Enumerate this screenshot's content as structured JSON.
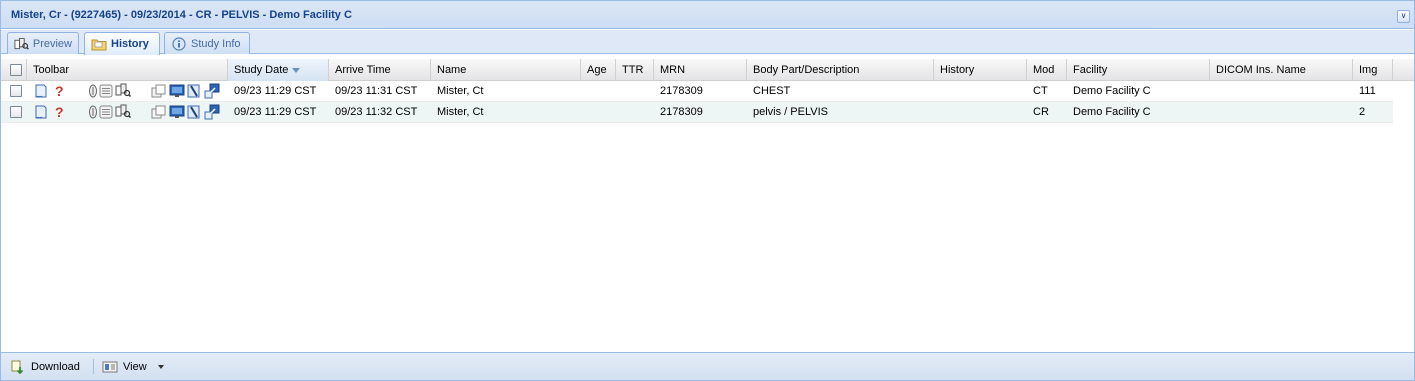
{
  "panel": {
    "title": "Mister, Cr - (9227465) - 09/23/2014 - CR - PELVIS - Demo Facility C"
  },
  "tabs": [
    {
      "label": "Preview",
      "icon": "preview-icon",
      "active": false
    },
    {
      "label": "History",
      "icon": "folder-icon",
      "active": true
    },
    {
      "label": "Study Info",
      "icon": "info-icon",
      "active": false
    }
  ],
  "grid": {
    "columns": [
      "Toolbar",
      "Study Date",
      "Arrive Time",
      "Name",
      "Age",
      "TTR",
      "MRN",
      "Body Part/Description",
      "History",
      "Mod",
      "Facility",
      "DICOM Ins. Name",
      "Img"
    ],
    "sorted_column": "Study Date",
    "sort_direction": "desc",
    "rows": [
      {
        "study_date": "09/23 11:29 CST",
        "arrive_time": "09/23 11:31 CST",
        "name": "Mister, Ct",
        "age": "",
        "ttr": "",
        "mrn": "2178309",
        "body_part": "CHEST",
        "history": "",
        "mod": "CT",
        "facility": "Demo Facility C",
        "dicom_name": "",
        "img": "111"
      },
      {
        "study_date": "09/23 11:29 CST",
        "arrive_time": "09/23 11:32 CST",
        "name": "Mister, Ct",
        "age": "",
        "ttr": "",
        "mrn": "2178309",
        "body_part": "pelvis / PELVIS",
        "history": "",
        "mod": "CR",
        "facility": "Demo Facility C",
        "dicom_name": "",
        "img": "2"
      }
    ],
    "row_icons": [
      "report-icon",
      "help-icon",
      "attachment-icon",
      "notes-icon",
      "preview-icon",
      "documents-icon",
      "monitor-icon",
      "dictation-icon",
      "send-icon"
    ]
  },
  "bottombar": {
    "download_label": "Download",
    "view_label": "View"
  },
  "colors": {
    "title": "#15428b",
    "border": "#99bbe8",
    "alt_row": "#eef5f5",
    "help": "#c0392b"
  }
}
